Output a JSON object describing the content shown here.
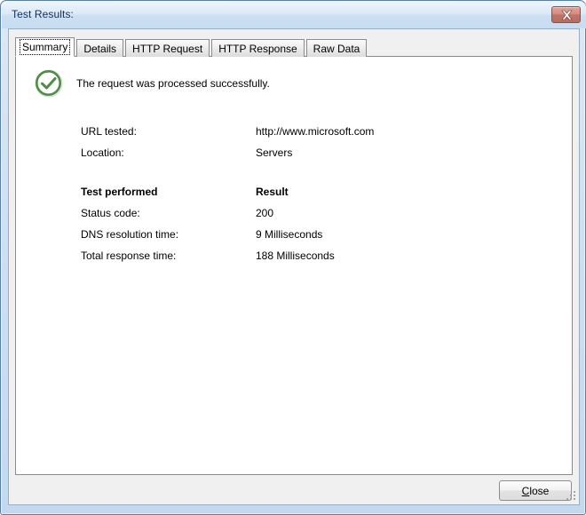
{
  "window": {
    "title": "Test Results:",
    "close_icon": "close-x-icon",
    "accent_title_color": "#11305a",
    "close_button_color": "#c07468",
    "frame_color": "#c3d9ef"
  },
  "tabs": [
    {
      "label": "Summary",
      "active": true
    },
    {
      "label": "Details",
      "active": false
    },
    {
      "label": "HTTP Request",
      "active": false
    },
    {
      "label": "HTTP Response",
      "active": false
    },
    {
      "label": "Raw Data",
      "active": false
    }
  ],
  "summary": {
    "status_icon": "success-check-circle-icon",
    "status_icon_color": "#5a9e52",
    "status_message": "The request was processed successfully.",
    "details": [
      {
        "label": "URL tested:",
        "value": "http://www.microsoft.com"
      },
      {
        "label": "Location:",
        "value": "Servers"
      }
    ],
    "results_header": {
      "label": "Test performed",
      "value": "Result"
    },
    "results": [
      {
        "label": "Status code:",
        "value": "200"
      },
      {
        "label": "DNS resolution time:",
        "value": "9 Milliseconds"
      },
      {
        "label": "Total response time:",
        "value": "188 Milliseconds"
      }
    ]
  },
  "footer": {
    "close_button": {
      "accel": "C",
      "rest": "lose"
    }
  }
}
